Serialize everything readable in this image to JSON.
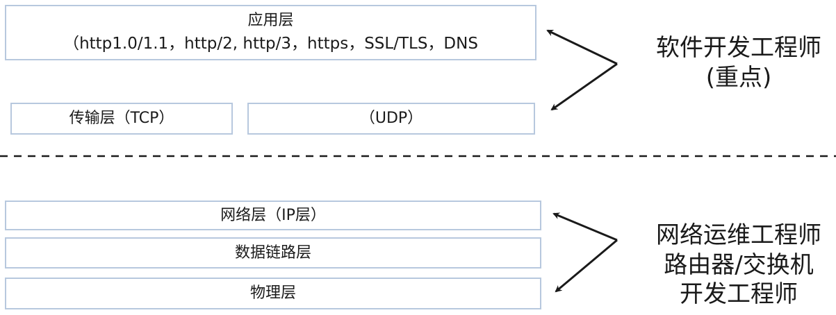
{
  "layers": {
    "application": {
      "title": "应用层",
      "protocols": "（http1.0/1.1，http/2, http/3，https，SSL/TLS，DNS"
    },
    "transport_tcp": "传输层（TCP）",
    "transport_udp": "（UDP）",
    "network": "网络层（IP层）",
    "data_link": "数据链路层",
    "physical": "物理层"
  },
  "annotations": {
    "software": {
      "line1": "软件开发工程师",
      "line2": "(重点)"
    },
    "ops": {
      "line1": "网络运维工程师",
      "line2": "路由器/交换机",
      "line3": "开发工程师"
    }
  }
}
